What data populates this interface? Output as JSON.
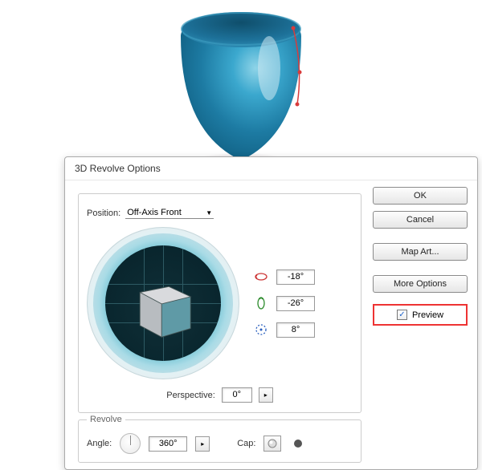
{
  "dialog": {
    "title": "3D Revolve Options",
    "position": {
      "label": "Position:",
      "value": "Off-Axis Front",
      "angles": {
        "x": "-18°",
        "y": "-26°",
        "z": "8°"
      },
      "perspective_label": "Perspective:",
      "perspective_value": "0°"
    },
    "revolve": {
      "label": "Revolve",
      "angle_label": "Angle:",
      "angle_value": "360°",
      "cap_label": "Cap:"
    },
    "buttons": {
      "ok": "OK",
      "cancel": "Cancel",
      "map_art": "Map Art...",
      "more_options": "More Options"
    },
    "preview": {
      "label": "Preview",
      "checked": "✓"
    }
  }
}
